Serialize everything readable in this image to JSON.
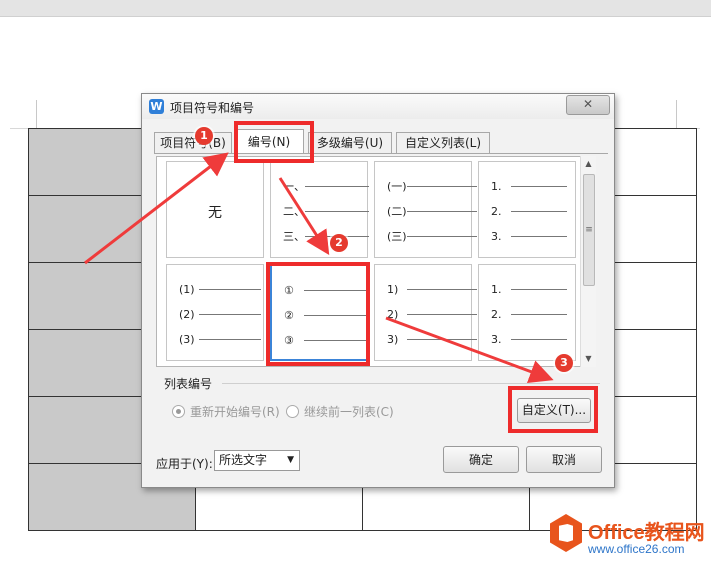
{
  "dialog": {
    "title": "项目符号和编号",
    "app_icon": "W",
    "close_glyph": "✕"
  },
  "tabs": [
    {
      "label": "项目符号(B)"
    },
    {
      "label": "编号(N)"
    },
    {
      "label": "多级编号(U)"
    },
    {
      "label": "自定义列表(L)"
    }
  ],
  "gallery": {
    "none_label": "无",
    "styles": [
      [
        "一、",
        "二、",
        "三、"
      ],
      [
        "(一)",
        "(二)",
        "(三)"
      ],
      [
        "1.",
        "2.",
        "3."
      ],
      [
        "(1)",
        "(2)",
        "(3)"
      ],
      [
        "①",
        "②",
        "③"
      ],
      [
        "1)",
        "2)",
        "3)"
      ],
      [
        "1.",
        "2.",
        "3."
      ]
    ],
    "selected_index": 5
  },
  "list_numbering": {
    "group_label": "列表编号",
    "restart_label": "重新开始编号(R)",
    "continue_label": "继续前一列表(C)",
    "customize_button": "自定义(T)..."
  },
  "footer": {
    "apply_label": "应用于(Y):",
    "apply_value": "所选文字",
    "ok_button": "确定",
    "cancel_button": "取消"
  },
  "annotations": {
    "badges": [
      "1",
      "2",
      "3"
    ],
    "arrow_color": "#ef3b3b"
  },
  "watermark": {
    "title": "Office教程网",
    "url": "www.office26.com"
  }
}
